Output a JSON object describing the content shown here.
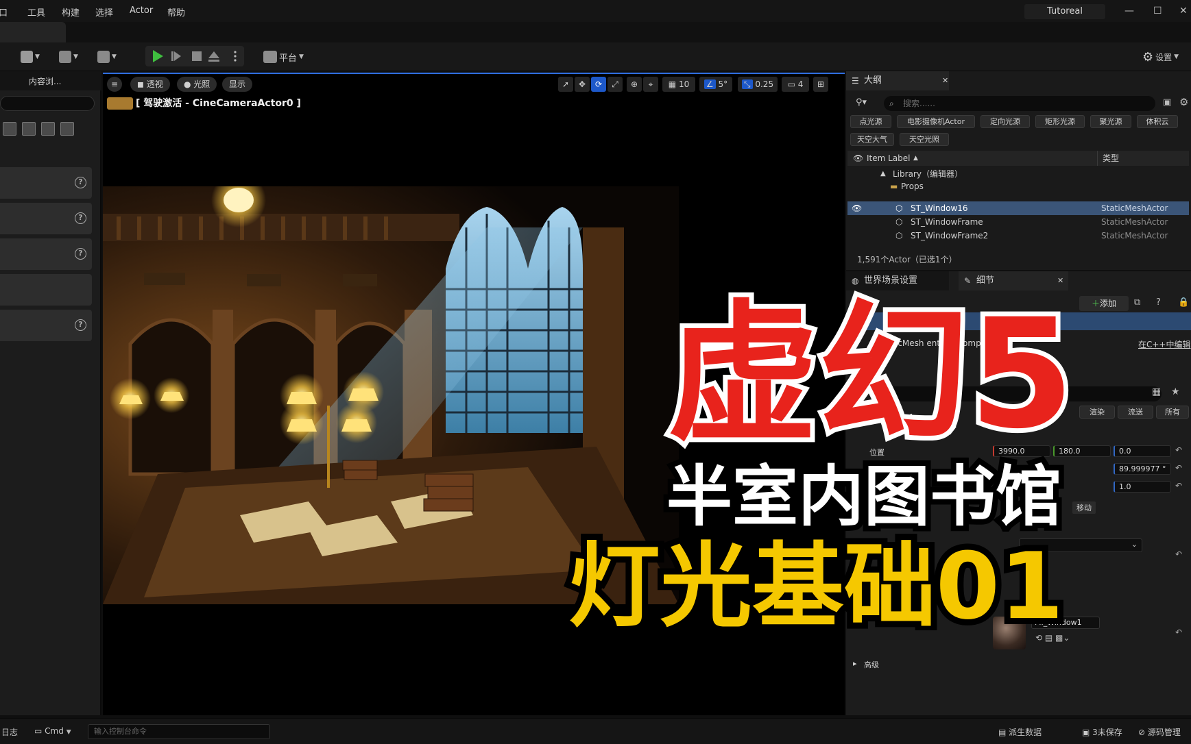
{
  "menubar": {
    "items": [
      "口",
      "工具",
      "构建",
      "选择",
      "Actor",
      "帮助"
    ],
    "app_name": "Tutoreal",
    "window_buttons": [
      "minimize-icon",
      "maximize-icon",
      "close-icon"
    ]
  },
  "toolbar": {
    "platform_label": "平台",
    "settings_label": "设置"
  },
  "left_panel": {
    "tab_label": "内容浏..."
  },
  "viewport": {
    "menu_icon": "hamburger-icon",
    "perspective_label": "透视",
    "lighting_label": "光照",
    "show_label": "显示",
    "camera_label": "[ 驾驶激活 - CineCameraActor0 ]",
    "grid_value": "10",
    "angle_value": "5°",
    "scale_value": "0.25",
    "camera_speed_value": "4"
  },
  "outliner": {
    "tab_label": "大纲",
    "search_placeholder": "搜索......",
    "filter_chips": [
      "点光源",
      "电影摄像机Actor",
      "定向光源",
      "矩形光源",
      "聚光源",
      "体积云",
      "天空大气",
      "天空光照"
    ],
    "columns": {
      "label": "Item Label",
      "type": "类型"
    },
    "rows": [
      {
        "label": "Library（编辑器）",
        "type": ""
      },
      {
        "label": "Props",
        "type": ""
      },
      {
        "label": "ST_Window16",
        "type": "StaticMeshActor",
        "selected": true
      },
      {
        "label": "ST_WindowFrame",
        "type": "StaticMeshActor"
      },
      {
        "label": "ST_WindowFrame2",
        "type": "StaticMeshActor"
      }
    ],
    "footer": "1,591个Actor（已选1个）"
  },
  "details": {
    "world_settings_tab": "世界场景设置",
    "details_tab": "细节",
    "add_button": "添加",
    "component_text": "icMesh      ent (St        Component0)",
    "cpp_link": "在C++中编辑",
    "filter_tabs": [
      "渲染",
      "流送",
      "所有"
    ],
    "location_label": "位置",
    "location": [
      "3990.0",
      "180.0",
      "0.0"
    ],
    "rotation_z": "89.999977 °",
    "scale_z": "1.0",
    "mobility_text": "移动",
    "material_label": "MI_Window1",
    "advanced_label": "高级"
  },
  "statusbar": {
    "log_label": "日志",
    "cmd_label": "Cmd",
    "cmd_placeholder": "输入控制台命令",
    "derived_data": "派生数据",
    "unsaved": "3未保存",
    "source_control": "源码管理"
  },
  "overlay": {
    "title": "虚幻5",
    "subtitle": "半室内图书馆",
    "episode": "灯光基础01",
    "colors": {
      "title_red": "#e8231c",
      "episode_yellow": "#f5c800",
      "outline": "#000000"
    }
  }
}
